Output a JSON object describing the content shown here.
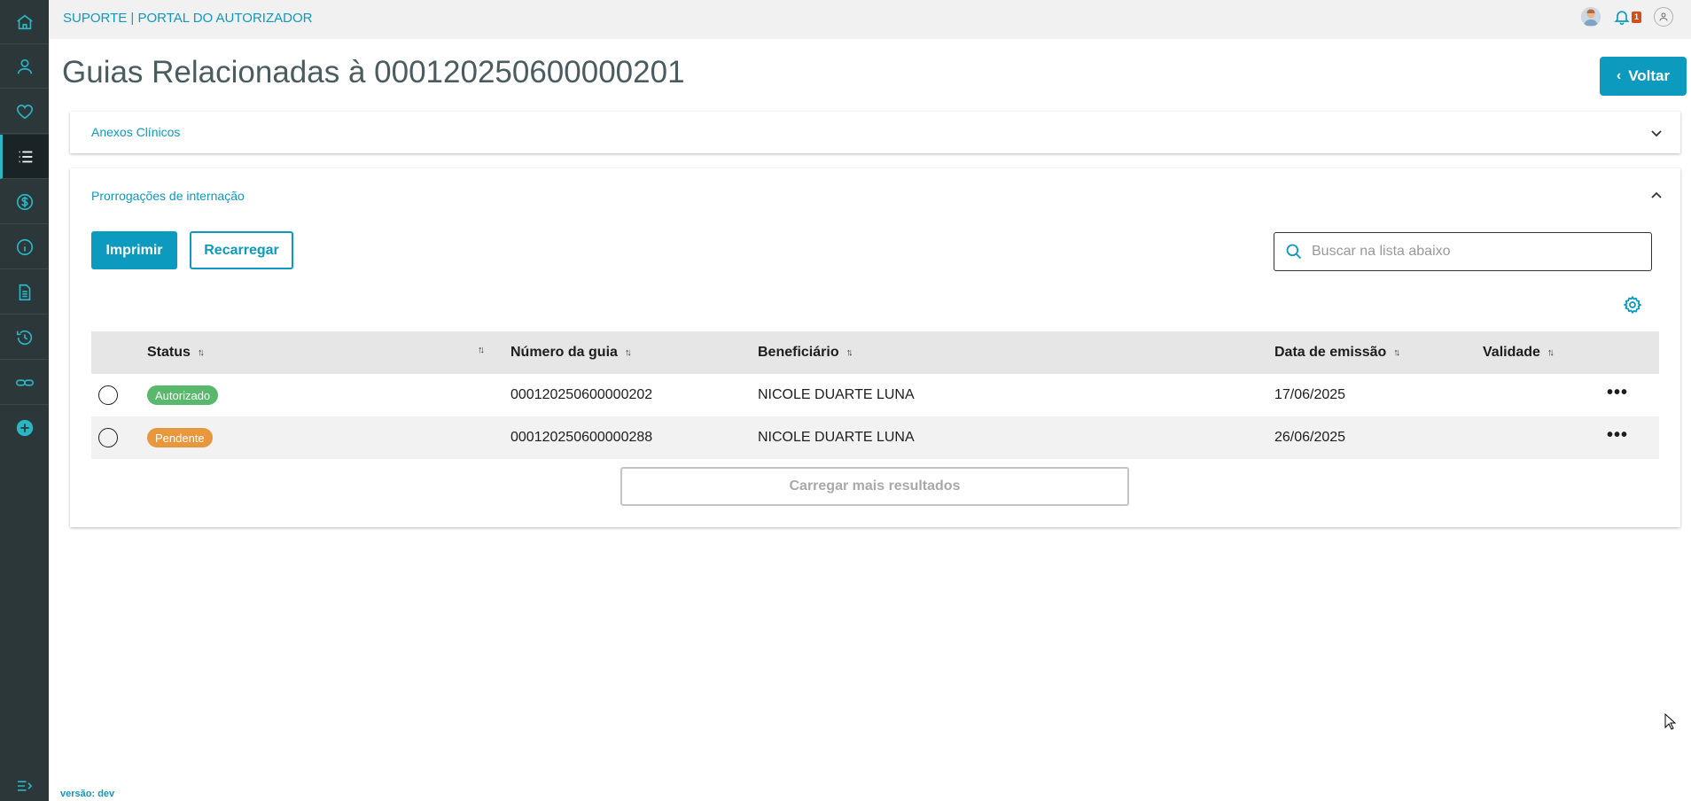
{
  "brand": "SUPORTE | PORTAL DO AUTORIZADOR",
  "notifications": {
    "count": "1"
  },
  "page": {
    "title": "Guias Relacionadas à 00012025060000020 1",
    "back_label": "Voltar"
  },
  "sections": {
    "anexos": {
      "title": "Anexos Clínicos"
    },
    "prorrogacoes": {
      "title": "Prorrogações de internação"
    }
  },
  "toolbar": {
    "print_label": "Imprimir",
    "reload_label": "Recarregar",
    "search_placeholder": "Buscar na lista abaixo"
  },
  "table": {
    "columns": [
      "Status",
      "",
      "Número da guia",
      "Beneficiário",
      "Data de emissão",
      "Validade"
    ],
    "rows": [
      {
        "status": "Autorizado",
        "status_color": "#59b86b",
        "numero": "000120250600000202",
        "beneficiario": "NICOLE DUARTE LUNA",
        "data_emissao": "17/06/2025",
        "validade": ""
      },
      {
        "status": "Pendente",
        "status_color": "#e9973d",
        "numero": "000120250600000288",
        "beneficiario": "NICOLE DUARTE LUNA",
        "data_emissao": "26/06/2025",
        "validade": ""
      }
    ],
    "load_more_label": "Carregar mais resultados"
  },
  "version": "versão: dev",
  "colors": {
    "accent": "#0c9abe",
    "sidebar": "#2c3739"
  }
}
